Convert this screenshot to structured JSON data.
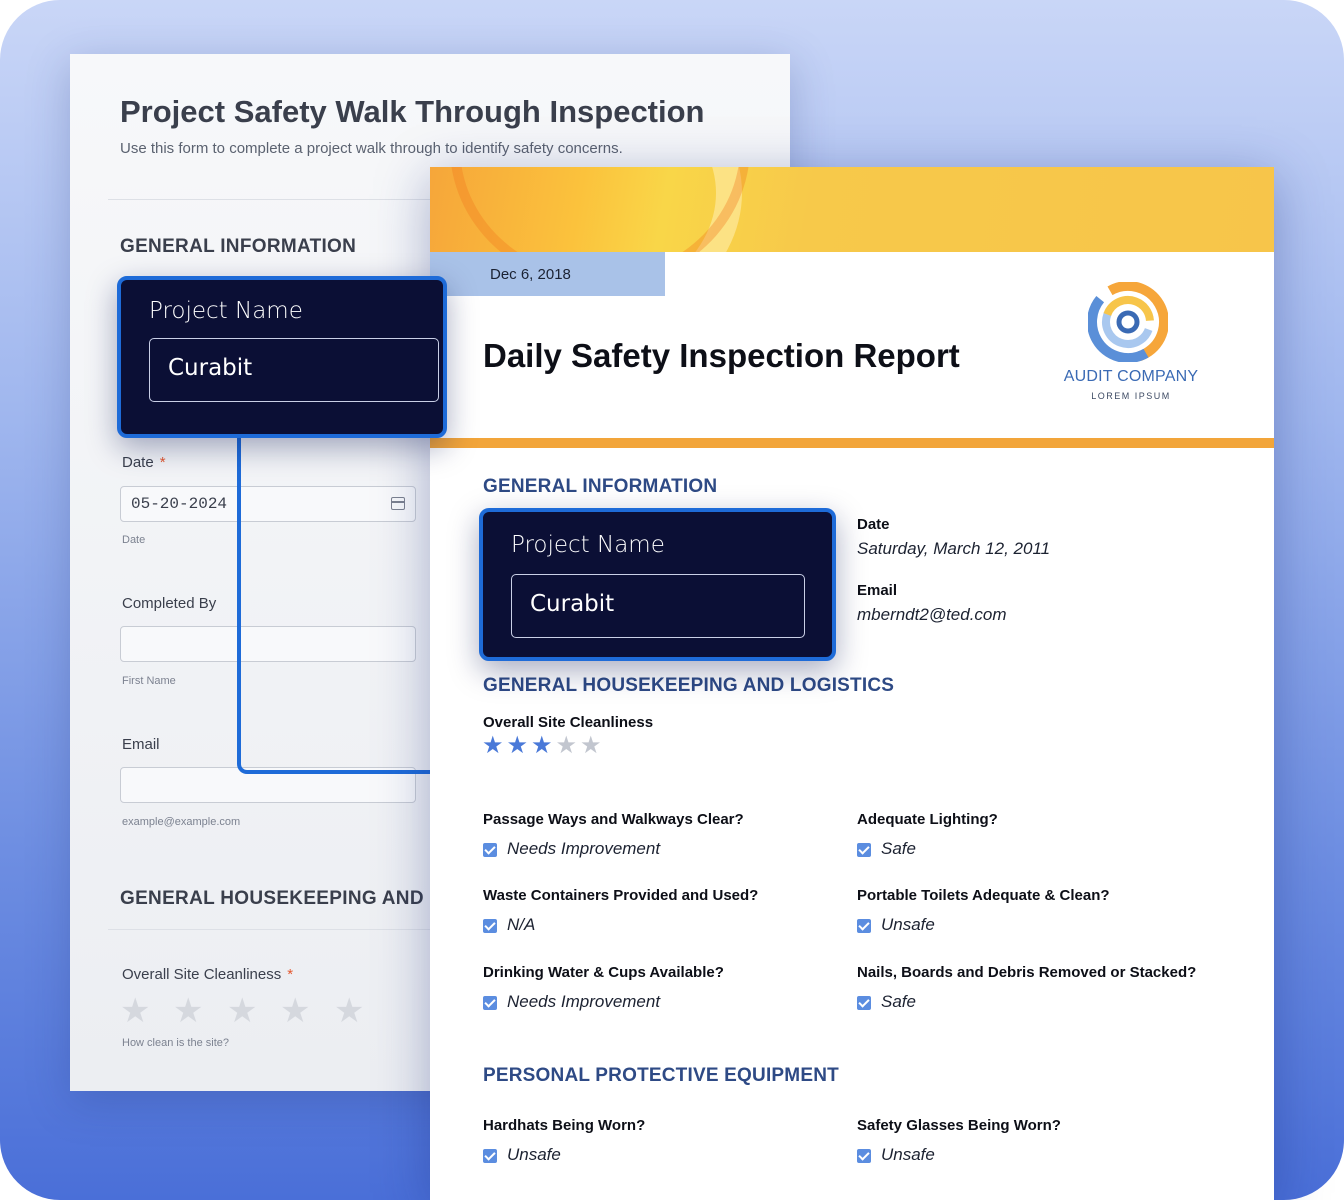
{
  "form": {
    "title": "Project Safety Walk Through Inspection",
    "subtitle": "Use this form to complete a project walk through to identify safety concerns.",
    "section_general": "GENERAL INFORMATION",
    "date_label": "Date",
    "date_value": "05-20-2024",
    "date_hint": "Date",
    "completed_by_label": "Completed By",
    "first_name_hint": "First Name",
    "email_label": "Email",
    "email_hint": "example@example.com",
    "section_housekeeping": "GENERAL HOUSEKEEPING AND LO",
    "cleanliness_label": "Overall Site Cleanliness",
    "cleanliness_hint": "How clean is the site?",
    "required_mark": "*",
    "star_glyph": "★"
  },
  "callouts": {
    "label": "Project Name",
    "value": "Curabit"
  },
  "report": {
    "date": "Dec 6, 2018",
    "title": "Daily Safety Inspection Report",
    "company_name": "AUDIT COMPANY",
    "company_sub": "LOREM IPSUM",
    "section_general": "GENERAL INFORMATION",
    "date_label": "Date",
    "date_value": "Saturday, March 12, 2011",
    "email_label": "Email",
    "email_value": "mberndt2@ted.com",
    "section_housekeeping": "GENERAL HOUSEKEEPING AND LOGISTICS",
    "cleanliness_label": "Overall Site Cleanliness",
    "cleanliness_rating": 3,
    "cleanliness_max": 5,
    "section_ppe": "PERSONAL PROTECTIVE EQUIPMENT",
    "questions": [
      {
        "label": "Passage Ways and Walkways Clear?",
        "value": "Needs Improvement"
      },
      {
        "label": "Adequate Lighting?",
        "value": "Safe"
      },
      {
        "label": "Waste Containers Provided and Used?",
        "value": "N/A"
      },
      {
        "label": "Portable Toilets Adequate & Clean?",
        "value": "Unsafe"
      },
      {
        "label": "Drinking Water & Cups Available?",
        "value": "Needs Improvement"
      },
      {
        "label": "Nails, Boards and Debris Removed or Stacked?",
        "value": "Safe"
      },
      {
        "label": "Hardhats Being Worn?",
        "value": "Unsafe"
      },
      {
        "label": "Safety Glasses Being Worn?",
        "value": "Unsafe"
      }
    ]
  },
  "colors": {
    "accent": "#1e6bd8",
    "callout_bg": "#0b0f35",
    "section_heading": "#2e4a85",
    "banner": "#f7c54a",
    "orange_bar": "#f2a53a",
    "star_on": "#4a79d8"
  },
  "icons": [
    "calendar-icon",
    "star-icon",
    "checkbox-checked-icon",
    "company-logo"
  ]
}
